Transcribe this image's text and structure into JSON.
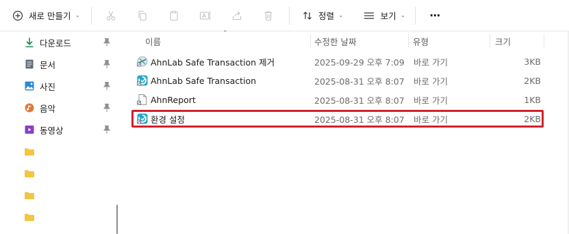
{
  "toolbar": {
    "new_label": "새로 만들기",
    "sort_label": "정렬",
    "view_label": "보기",
    "more_label": "···"
  },
  "sidebar": {
    "items": [
      {
        "label": "다운로드",
        "icon": "download-icon"
      },
      {
        "label": "문서",
        "icon": "document-icon"
      },
      {
        "label": "사진",
        "icon": "pictures-icon"
      },
      {
        "label": "음악",
        "icon": "music-icon"
      },
      {
        "label": "동영상",
        "icon": "video-icon"
      }
    ],
    "folders": [
      "folder-icon",
      "folder-icon",
      "folder-icon",
      "folder-icon"
    ]
  },
  "columns": {
    "name": "이름",
    "date": "수정한 날짜",
    "type": "유형",
    "size": "크기"
  },
  "files": [
    {
      "name": "AhnLab Safe Transaction 제거",
      "date": "2025-09-29 오후 7:09",
      "type": "바로 가기",
      "size": "3KB",
      "icon": "uninstall-shortcut-icon"
    },
    {
      "name": "AhnLab Safe Transaction",
      "date": "2025-08-31 오후 8:07",
      "type": "바로 가기",
      "size": "2KB",
      "icon": "ahnlab-shortcut-icon"
    },
    {
      "name": "AhnReport",
      "date": "2025-08-31 오후 8:07",
      "type": "바로 가기",
      "size": "1KB",
      "icon": "file-shortcut-icon"
    },
    {
      "name": "환경 설정",
      "date": "2025-08-31 오후 8:07",
      "type": "바로 가기",
      "size": "2KB",
      "icon": "ahnlab-shortcut-icon"
    }
  ],
  "colors": {
    "highlight": "#d0212b",
    "folder": "#f4c542",
    "accent": "#2b88d8"
  }
}
